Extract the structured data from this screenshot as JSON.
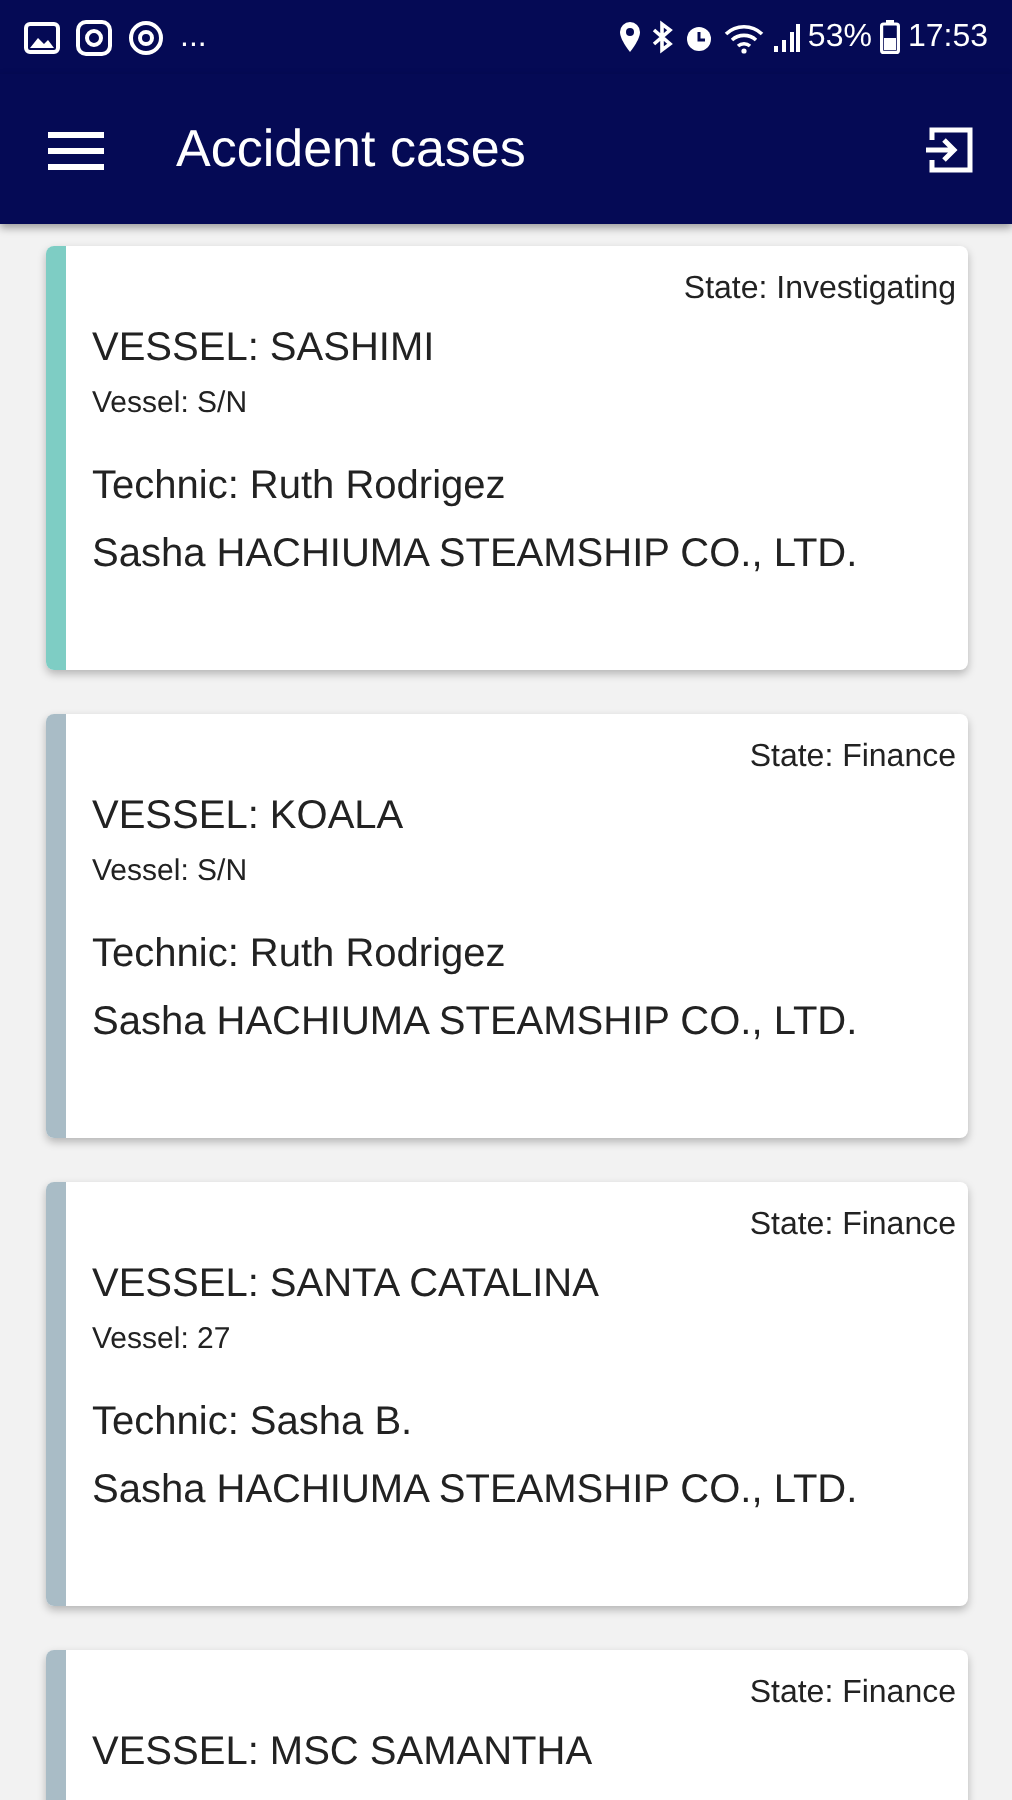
{
  "status_bar": {
    "overflow": "...",
    "battery": "53%",
    "time": "17:53"
  },
  "app_bar": {
    "title": "Accident cases"
  },
  "cases": [
    {
      "state": "State: Investigating",
      "vessel": "VESSEL: SASHIMI",
      "vessel_no": "Vessel: S/N",
      "technic": "Technic: Ruth Rodrigez",
      "company": "Sasha HACHIUMA STEAMSHIP CO., LTD.",
      "color": "#7ecdc4"
    },
    {
      "state": "State: Finance",
      "vessel": "VESSEL: KOALA",
      "vessel_no": "Vessel: S/N",
      "technic": "Technic: Ruth Rodrigez",
      "company": "Sasha HACHIUMA STEAMSHIP CO., LTD.",
      "color": "#a9bcc6"
    },
    {
      "state": "State: Finance",
      "vessel": "VESSEL: SANTA CATALINA",
      "vessel_no": "Vessel: 27",
      "technic": "Technic: Sasha B.",
      "company": "Sasha HACHIUMA STEAMSHIP CO., LTD.",
      "color": "#a9bcc6"
    },
    {
      "state": "State: Finance",
      "vessel": "VESSEL: MSC SAMANTHA",
      "color": "#a9bcc6"
    }
  ]
}
